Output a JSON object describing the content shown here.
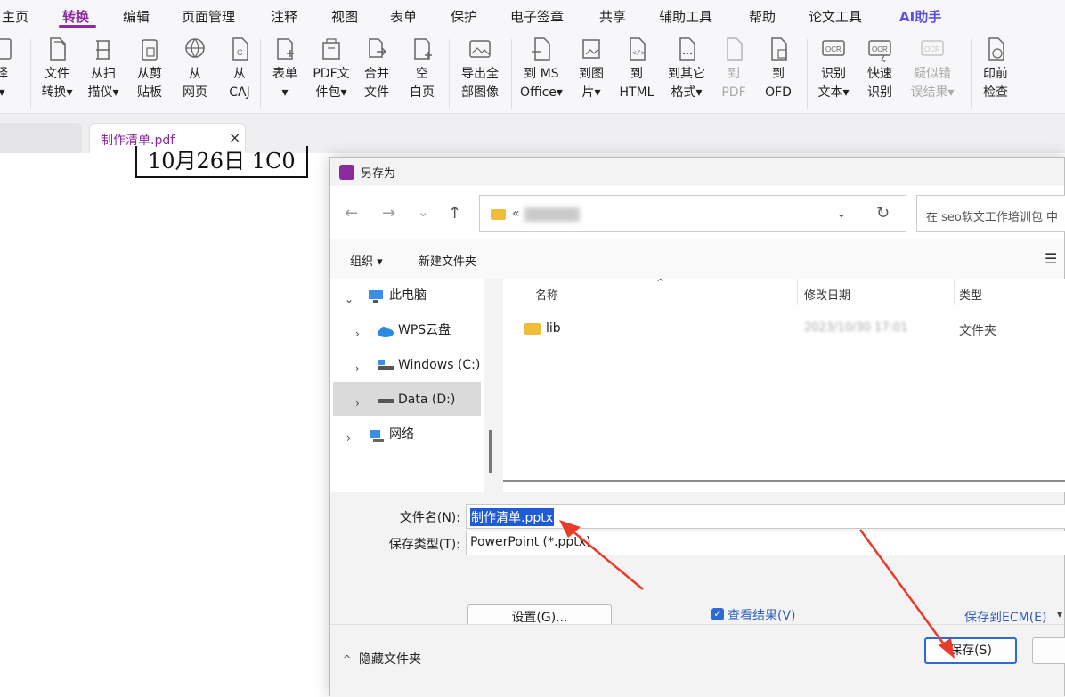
{
  "menu": {
    "items": [
      "主页",
      "转换",
      "编辑",
      "页面管理",
      "注释",
      "视图",
      "表单",
      "保护",
      "电子签章",
      "共享",
      "辅助工具",
      "帮助",
      "论文工具",
      "AI助手"
    ],
    "active": "转换"
  },
  "ribbon": {
    "buttons": [
      {
        "label": "择\n▾"
      },
      {
        "label": "文件\n转换▾"
      },
      {
        "label": "从扫\n描仪▾"
      },
      {
        "label": "从剪\n贴板"
      },
      {
        "label": "从\n网页"
      },
      {
        "label": "从\nCAJ"
      },
      {
        "label": "表单\n▾"
      },
      {
        "label": "PDF文\n件包▾"
      },
      {
        "label": "合并\n文件"
      },
      {
        "label": "空\n白页"
      },
      {
        "label": "导出全\n部图像"
      },
      {
        "label": "到 MS\nOffice▾"
      },
      {
        "label": "到图\n片▾"
      },
      {
        "label": "到\nHTML"
      },
      {
        "label": "到其它\n格式▾"
      },
      {
        "label": "到\nPDF"
      },
      {
        "label": "到\nOFD"
      },
      {
        "label": "识别\n文本▾"
      },
      {
        "label": "快速\n识别"
      },
      {
        "label": "疑似错\n误结果▾"
      },
      {
        "label": "印前\n检查"
      }
    ],
    "disabled": [
      "到\nPDF",
      "疑似错\n误结果▾"
    ]
  },
  "tab": {
    "title": "制作清单.pdf",
    "close": "×"
  },
  "document": {
    "line1": "10月26日 1C0",
    "line2": "…"
  },
  "dialog": {
    "title": "另存为",
    "nav": {
      "back": "←",
      "forward": "→",
      "dropdown": "⌄",
      "up": "↑"
    },
    "address": {
      "prefix": "«",
      "dropdown": "⌄",
      "refresh": "↻"
    },
    "search_placeholder": "在 seo软文工作培训包 中",
    "toolbar": {
      "organize": "组织 ▾",
      "new_folder": "新建文件夹",
      "view_menu": "☰"
    },
    "tree": [
      {
        "label": "此电脑",
        "expand": "⌄"
      },
      {
        "label": "WPS云盘",
        "expand": "›"
      },
      {
        "label": "Windows (C:)",
        "expand": "›"
      },
      {
        "label": "Data (D:)",
        "expand": "›"
      },
      {
        "label": "网络",
        "expand": "›"
      }
    ],
    "columns": {
      "name": "名称",
      "date": "修改日期",
      "type": "类型",
      "sort": "^"
    },
    "files": [
      {
        "name": "lib",
        "date": "2023/10/30 17:01",
        "type": "文件夹"
      }
    ],
    "filename_label": "文件名(N):",
    "filename_value": "制作清单.pptx",
    "filetype_label": "保存类型(T):",
    "filetype_value": "PowerPoint (*.pptx)",
    "settings_button": "设置(G)...",
    "view_result_label": "查看结果(V)",
    "view_result_checked": true,
    "save_to_ecm": "保存到ECM(E)",
    "ecm_dropdown": "▾",
    "hide_folders": "隐藏文件夹",
    "save_button": "保存(S)",
    "cancel_button": ""
  },
  "colors": {
    "accent": "#8a2ba0",
    "primary": "#2c6bd7",
    "folder": "#f1bc3a",
    "annotation_arrow": "#e83b2a"
  }
}
